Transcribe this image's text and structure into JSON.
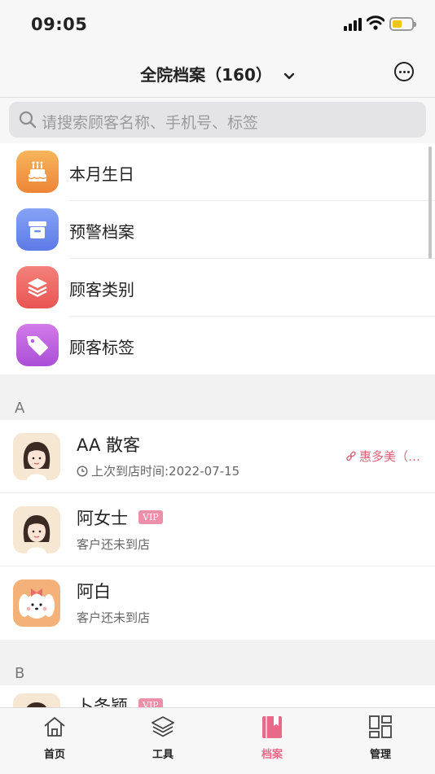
{
  "status_bar": {
    "time": "09:05"
  },
  "header": {
    "title": "全院档案（160）"
  },
  "search": {
    "placeholder": "请搜索顾客名称、手机号、标签"
  },
  "menu": [
    {
      "label": "本月生日",
      "icon": "cake-icon",
      "color": "#f29a46"
    },
    {
      "label": "预警档案",
      "icon": "archive-box-icon",
      "color": "#6f8df0"
    },
    {
      "label": "顾客类别",
      "icon": "layers-icon",
      "color": "#ef6a63"
    },
    {
      "label": "顾客标签",
      "icon": "tag-icon",
      "color": "#c25fe0"
    }
  ],
  "sections": [
    {
      "letter": "A",
      "customers": [
        {
          "name": "AA 散客",
          "subtitle": "上次到店时间:2022-07-15",
          "store": "惠多美（…"
        },
        {
          "name": "阿女士",
          "badge": "VIP",
          "subtitle": "客户还未到店"
        },
        {
          "name": "阿白",
          "subtitle": "客户还未到店"
        }
      ]
    },
    {
      "letter": "B",
      "customers": [
        {
          "name": "卜条颖",
          "badge": "VIP"
        }
      ]
    }
  ],
  "tabs": [
    {
      "label": "首页",
      "icon": "home-icon"
    },
    {
      "label": "工具",
      "icon": "layers-icon"
    },
    {
      "label": "档案",
      "icon": "bookmark-book-icon",
      "active": true
    },
    {
      "label": "管理",
      "icon": "grid-icon"
    }
  ],
  "colors": {
    "accent": "#e8698a",
    "vip": "#ec8fa8"
  }
}
